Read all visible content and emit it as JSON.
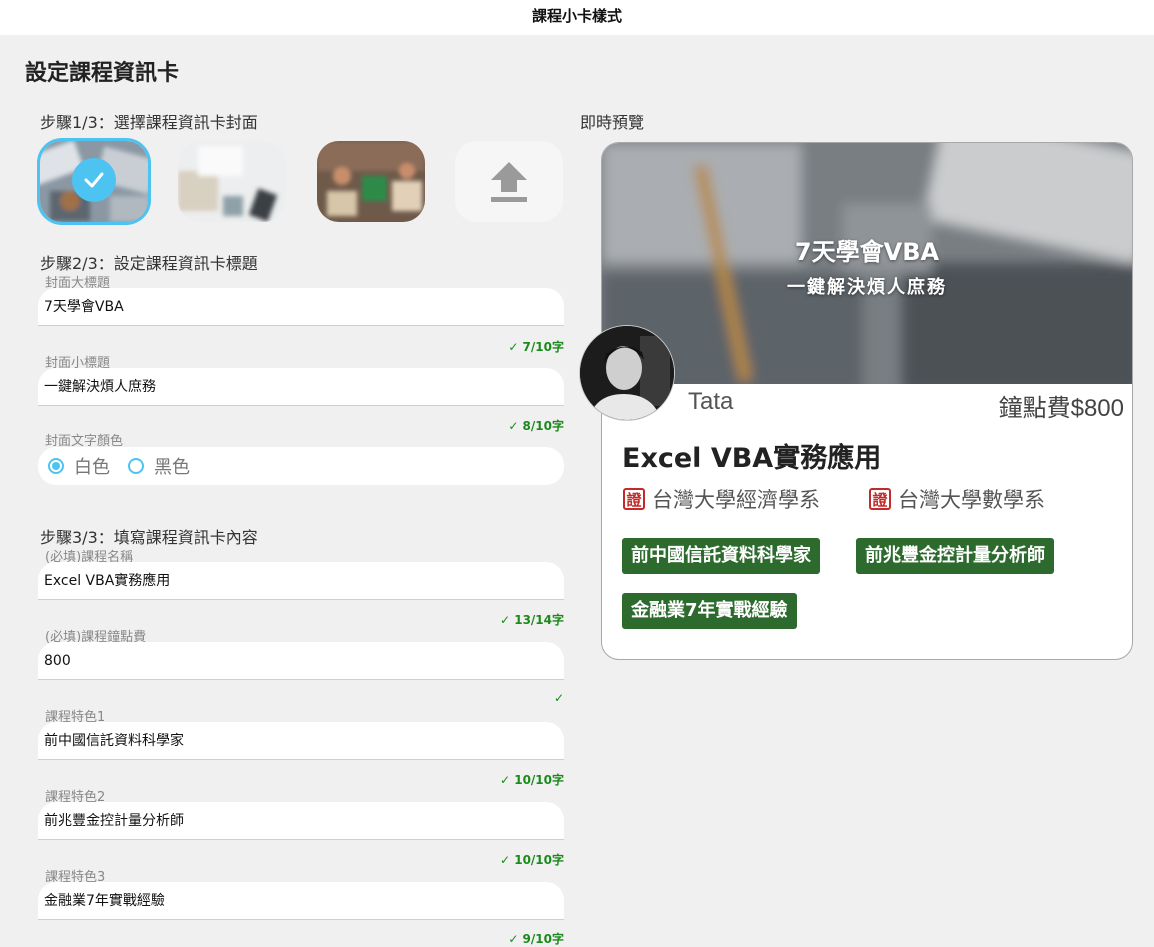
{
  "window_title": "課程小卡樣式",
  "page_title": "設定課程資訊卡",
  "step1": {
    "label": "步驟1/3：選擇課程資訊卡封面"
  },
  "step2": {
    "label": "步驟2/3：設定課程資訊卡標題",
    "main_title_label": "封面大標題",
    "main_title_value": "7天學會VBA",
    "main_title_counter": "✓ 7/10字",
    "sub_title_label": "封面小標題",
    "sub_title_value": "一鍵解決煩人庶務",
    "sub_title_counter": "✓ 8/10字",
    "color_label": "封面文字顏色",
    "color_white": "白色",
    "color_black": "黑色",
    "selected_color": "白色"
  },
  "step3": {
    "label": "步驟3/3：填寫課程資訊卡內容",
    "course_name_label": "(必填)課程名稱",
    "course_name_value": "Excel VBA實務應用",
    "course_name_counter": "✓ 13/14字",
    "fee_label": "(必填)課程鐘點費",
    "fee_value": "800",
    "fee_counter": "✓",
    "feature1_label": "課程特色1",
    "feature1_value": "前中國信託資料科學家",
    "feature1_counter": "✓ 10/10字",
    "feature2_label": "課程特色2",
    "feature2_value": "前兆豐金控計量分析師",
    "feature2_counter": "✓ 10/10字",
    "feature3_label": "課程特色3",
    "feature3_value": "金融業7年實戰經驗",
    "feature3_counter": "✓ 9/10字"
  },
  "preview": {
    "label": "即時預覽",
    "cover_title": "7天學會VBA",
    "cover_subtitle": "一鍵解決煩人庶務",
    "teacher_name": "Tata",
    "fee_text": "鐘點費$800",
    "course_name": "Excel VBA實務應用",
    "cert_icon_text": "證",
    "cert1": "台灣大學經濟學系",
    "cert2": "台灣大學數學系",
    "tags": [
      "前中國信託資料科學家",
      "前兆豐金控計量分析師",
      "金融業7年實戰經驗"
    ]
  },
  "colors": {
    "accent": "#4cc3f0",
    "tag_bg": "#2d6a2d",
    "counter_ok": "#1a8a1a",
    "cert_red": "#c52a2a"
  }
}
